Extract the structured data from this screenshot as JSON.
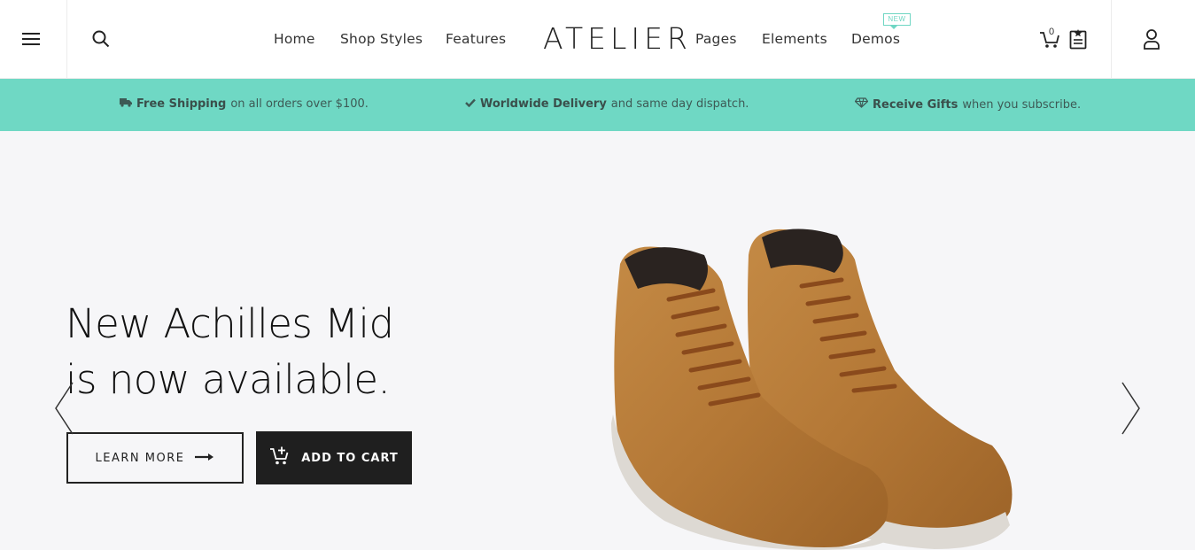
{
  "header": {
    "logo": "ATELIER",
    "nav_left": [
      "Home",
      "Shop Styles",
      "Features"
    ],
    "nav_right": [
      "Pages",
      "Elements",
      "Demos"
    ],
    "new_badge": "NEW",
    "cart_count": "0"
  },
  "promo": {
    "items": [
      {
        "bold": "Free Shipping",
        "text": "on all orders over $100.",
        "icon": "truck-icon"
      },
      {
        "bold": "Worldwide Delivery",
        "text": "and same day dispatch.",
        "icon": "check-icon"
      },
      {
        "bold": "Receive Gifts",
        "text": "when you subscribe.",
        "icon": "diamond-icon"
      }
    ],
    "color": "#6fd8c4"
  },
  "hero": {
    "headline_line1": "New Achilles Mid",
    "headline_line2": "is now available.",
    "learn_more": "LEARN MORE",
    "add_to_cart": "ADD TO CART",
    "image": "suede-sneakers-photo"
  }
}
